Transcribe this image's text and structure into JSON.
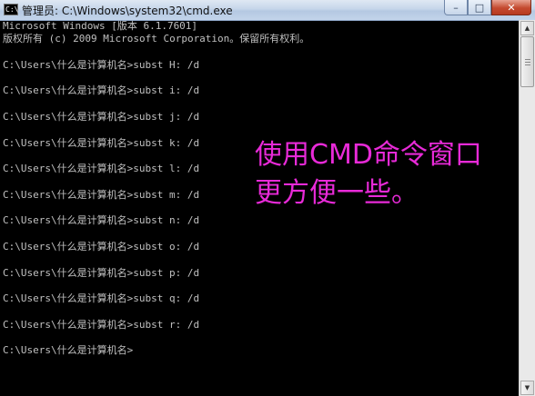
{
  "window": {
    "title": "管理员: C:\\Windows\\system32\\cmd.exe",
    "icon_label": "C:\\",
    "controls": {
      "minimize": "–",
      "maximize": "□",
      "close": "✕"
    }
  },
  "console": {
    "lines": [
      "Microsoft Windows [版本 6.1.7601]",
      "版权所有 (c) 2009 Microsoft Corporation。保留所有权利。",
      "",
      "C:\\Users\\什么是计算机名>subst H: /d",
      "",
      "C:\\Users\\什么是计算机名>subst i: /d",
      "",
      "C:\\Users\\什么是计算机名>subst j: /d",
      "",
      "C:\\Users\\什么是计算机名>subst k: /d",
      "",
      "C:\\Users\\什么是计算机名>subst l: /d",
      "",
      "C:\\Users\\什么是计算机名>subst m: /d",
      "",
      "C:\\Users\\什么是计算机名>subst n: /d",
      "",
      "C:\\Users\\什么是计算机名>subst o: /d",
      "",
      "C:\\Users\\什么是计算机名>subst p: /d",
      "",
      "C:\\Users\\什么是计算机名>subst q: /d",
      "",
      "C:\\Users\\什么是计算机名>subst r: /d",
      "",
      "C:\\Users\\什么是计算机名>"
    ]
  },
  "annotation": {
    "text": "使用CMD命令窗口更方便一些。",
    "color": "#e82ad8"
  },
  "colors": {
    "console_bg": "#000000",
    "console_fg": "#c0c0c0",
    "titlebar": "#c6d6ea"
  }
}
